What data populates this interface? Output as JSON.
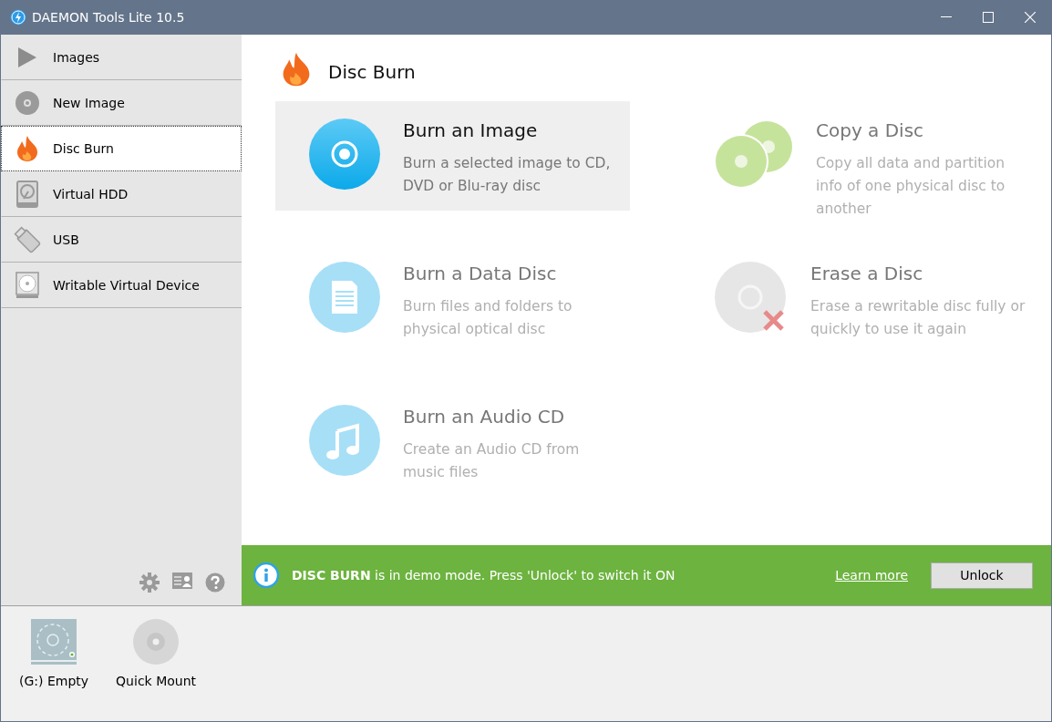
{
  "window": {
    "title": "DAEMON Tools Lite 10.5"
  },
  "sidebar": {
    "items": [
      {
        "label": "Images",
        "kind": "play",
        "selected": false
      },
      {
        "label": "New Image",
        "kind": "disc",
        "selected": false
      },
      {
        "label": "Disc Burn",
        "kind": "flame",
        "selected": true
      },
      {
        "label": "Virtual HDD",
        "kind": "hdd",
        "selected": false
      },
      {
        "label": "USB",
        "kind": "usb",
        "selected": false
      },
      {
        "label": "Writable Virtual Device",
        "kind": "drive",
        "selected": false
      }
    ]
  },
  "page": {
    "title": "Disc Burn",
    "tasks": [
      {
        "title": "Burn an Image",
        "description": "Burn a selected image to CD, DVD or Blu-ray disc",
        "kind": "image",
        "selected": true
      },
      {
        "title": "Copy a Disc",
        "description": "Copy all data and partition info of one physical disc to another",
        "kind": "copy",
        "selected": false
      },
      {
        "title": "Burn a Data Disc",
        "description": "Burn files and folders to physical optical disc",
        "kind": "data",
        "selected": false
      },
      {
        "title": "Erase a Disc",
        "description": "Erase a rewritable disc fully or quickly to use it again",
        "kind": "erase",
        "selected": false
      },
      {
        "title": "Burn an Audio CD",
        "description": "Create an Audio CD from music files",
        "kind": "audio",
        "selected": false
      }
    ]
  },
  "banner": {
    "message": "**DISC BURN** is in demo mode. Press 'Unlock' to switch it ON",
    "link": "Learn more",
    "button": "Unlock"
  },
  "devices": [
    {
      "label": "(G:) Empty",
      "kind": "drive"
    },
    {
      "label": "Quick Mount",
      "kind": "mount"
    }
  ]
}
